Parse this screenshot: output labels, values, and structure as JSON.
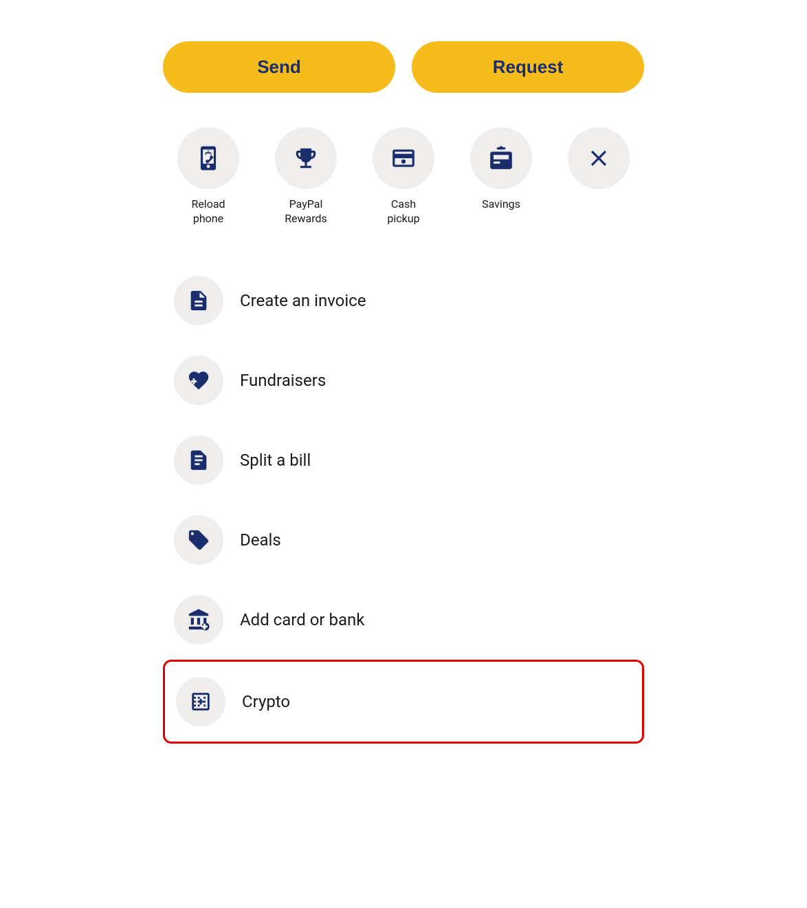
{
  "buttons": {
    "send_label": "Send",
    "request_label": "Request"
  },
  "quick_actions": [
    {
      "id": "reload-phone",
      "label": "Reload\nphone",
      "icon": "reload-phone-icon"
    },
    {
      "id": "paypal-rewards",
      "label": "PayPal\nRewards",
      "icon": "trophy-icon"
    },
    {
      "id": "cash-pickup",
      "label": "Cash\npickup",
      "icon": "cash-pickup-icon"
    },
    {
      "id": "savings",
      "label": "Savings",
      "icon": "savings-icon"
    },
    {
      "id": "close",
      "label": "",
      "icon": "close-icon"
    }
  ],
  "list_items": [
    {
      "id": "create-invoice",
      "label": "Create an invoice",
      "icon": "invoice-icon",
      "highlighted": false
    },
    {
      "id": "fundraisers",
      "label": "Fundraisers",
      "icon": "fundraisers-icon",
      "highlighted": false
    },
    {
      "id": "split-bill",
      "label": "Split a bill",
      "icon": "split-bill-icon",
      "highlighted": false
    },
    {
      "id": "deals",
      "label": "Deals",
      "icon": "deals-icon",
      "highlighted": false
    },
    {
      "id": "add-card-bank",
      "label": "Add card or bank",
      "icon": "add-bank-icon",
      "highlighted": false
    },
    {
      "id": "crypto",
      "label": "Crypto",
      "icon": "crypto-icon",
      "highlighted": true
    }
  ],
  "colors": {
    "brand_yellow": "#f5bc1c",
    "brand_navy": "#1a2e6e",
    "icon_bg": "#f0eeec",
    "highlight_border": "#e00000"
  }
}
